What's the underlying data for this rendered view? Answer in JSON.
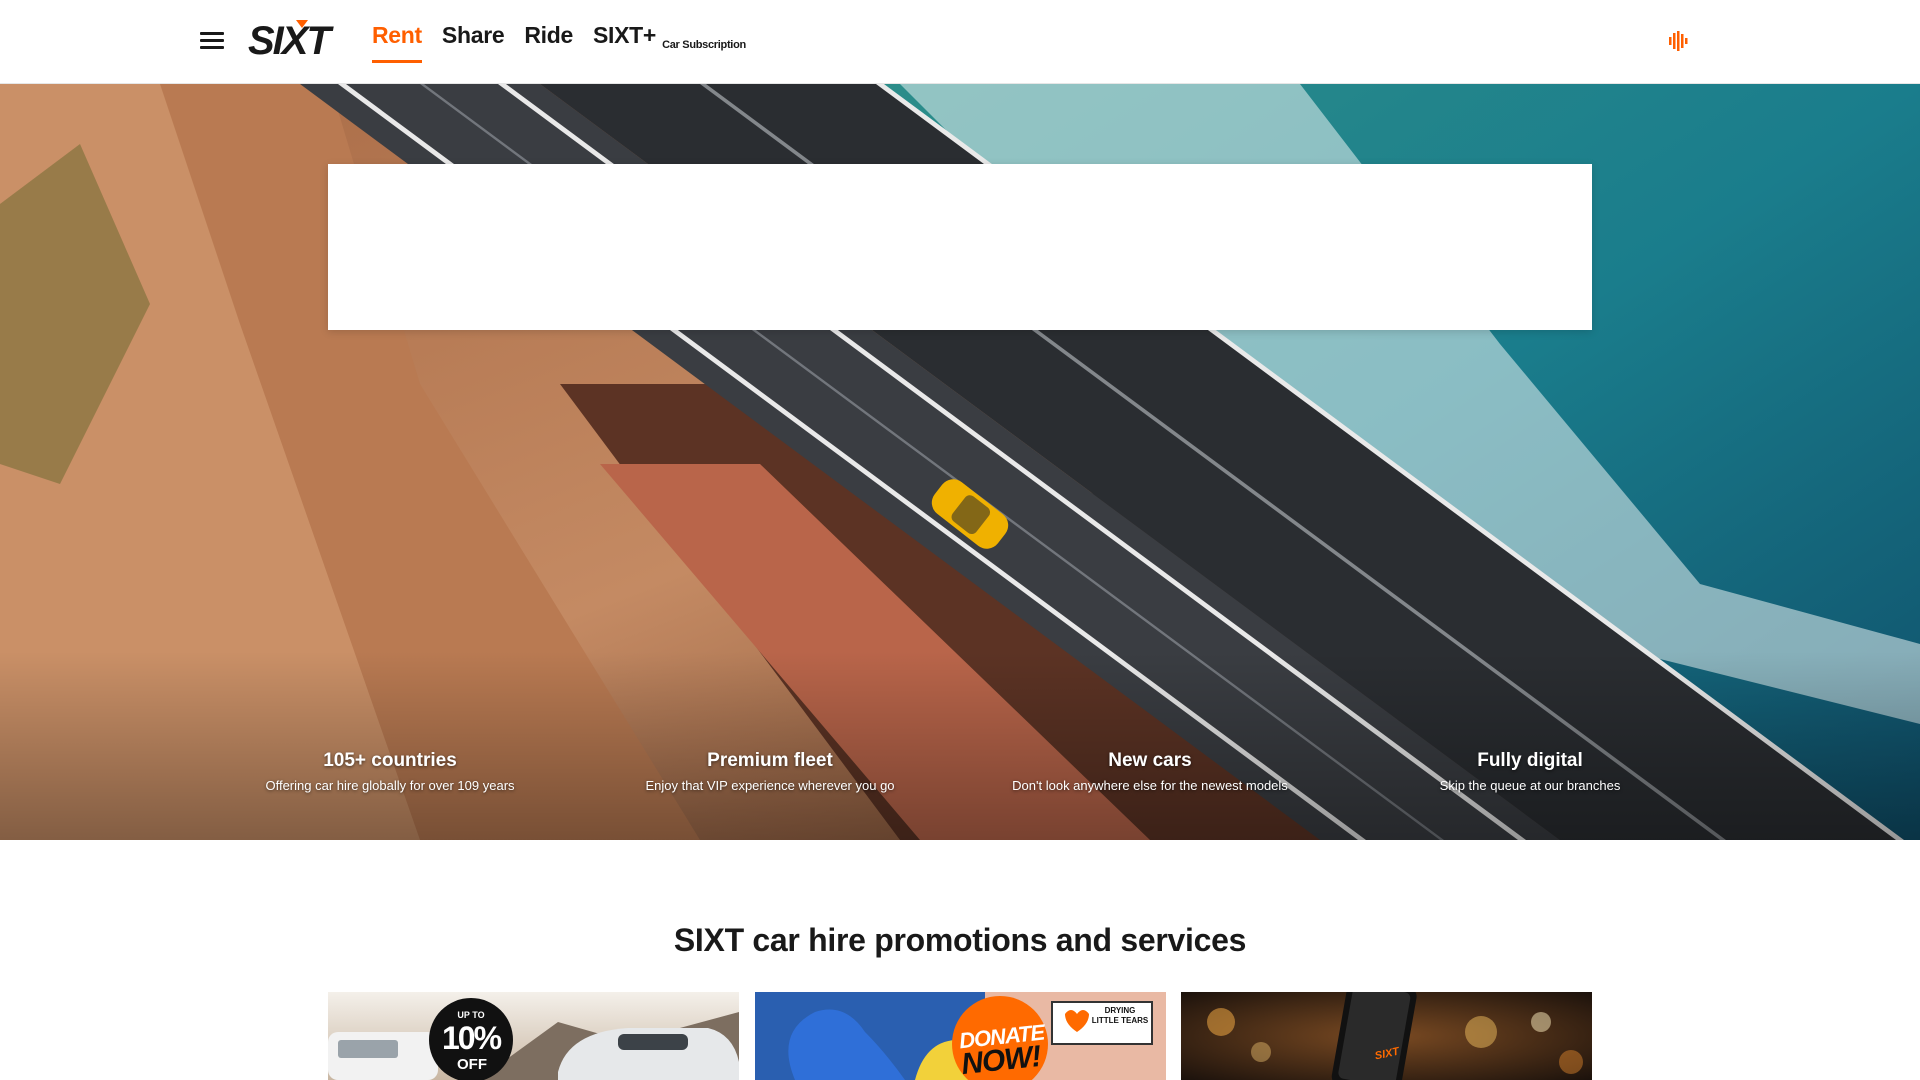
{
  "header": {
    "brand": "SIXT",
    "nav": [
      {
        "label": "Rent",
        "active": true
      },
      {
        "label": "Share",
        "active": false
      },
      {
        "label": "Ride",
        "active": false
      },
      {
        "label": "SIXT+",
        "active": false,
        "sublabel": "Car Subscription"
      }
    ],
    "accent_color": "#ff5f00"
  },
  "hero": {
    "usps": [
      {
        "title": "105+ countries",
        "text": "Offering car hire globally for over 109 years"
      },
      {
        "title": "Premium fleet",
        "text": "Enjoy that VIP experience wherever you go"
      },
      {
        "title": "New cars",
        "text": "Don't look anywhere else for the newest models"
      },
      {
        "title": "Fully digital",
        "text": "Skip the queue at our branches"
      }
    ]
  },
  "promotions": {
    "heading": "SIXT car hire promotions and services",
    "cards": [
      {
        "badge_top": "UP TO",
        "badge_main": "10%",
        "badge_bottom": "OFF"
      },
      {
        "badge_main": "DONATE",
        "badge_bottom": "NOW!",
        "partner_logo": "DRYING LITTLE TEARS"
      },
      {
        "phone_brand": "SIXT"
      }
    ]
  }
}
